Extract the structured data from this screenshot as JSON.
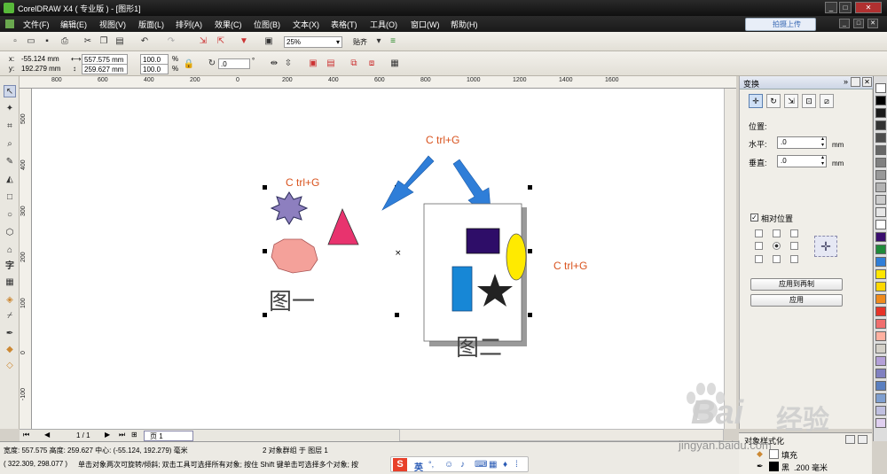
{
  "window": {
    "title": "CorelDRAW X4 ( 专业版 ) - [图形1]"
  },
  "menu": [
    "文件(F)",
    "编辑(E)",
    "视图(V)",
    "版面(L)",
    "排列(A)",
    "效果(C)",
    "位图(B)",
    "文本(X)",
    "表格(T)",
    "工具(O)",
    "窗口(W)",
    "帮助(H)"
  ],
  "upload_button": "拍摄上传",
  "toolbar": {
    "zoom": "25%",
    "snap": "贴齐"
  },
  "property_bar": {
    "x_label": "x:",
    "x": "-55.124 mm",
    "y_label": "y:",
    "y": "192.279 mm",
    "width": "557.575 mm",
    "height": "259.627 mm",
    "scale_w": "100.0",
    "scale_h": "100.0",
    "percent": "%",
    "rotation": ".0",
    "degree": "°"
  },
  "rulers": {
    "top": [
      "800",
      "600",
      "400",
      "200",
      "0",
      "200",
      "400",
      "600",
      "800",
      "1000",
      "1200",
      "1400",
      "1600"
    ],
    "left": [
      "500",
      "400",
      "300",
      "200",
      "100",
      "0",
      "-100"
    ]
  },
  "canvas": {
    "label_ctrlg_1": "C trl+G",
    "label_ctrlg_2": "C trl+G",
    "label_ctrlg_3": "C trl+G",
    "fig1_caption": "图一",
    "fig2_caption": "图二"
  },
  "docker": {
    "title": "变换",
    "position_label": "位置:",
    "h_label": "水平:",
    "h_value": ".0",
    "v_label": "垂直:",
    "v_value": ".0",
    "unit": "mm",
    "relative_label": "相对位置",
    "relative_checked": true,
    "apply_copy": "应用到再制",
    "apply": "应用"
  },
  "page_nav": {
    "counter": "1 / 1",
    "tab": "页 1"
  },
  "status": {
    "size": "宽度: 557.575 高度: 259.627 中心: (-55.124, 192.279) 毫米",
    "group": "2 对象群组 于 图层 1",
    "cursor": "( 322.309, 298.077 )",
    "hint": "单击对象两次可旋转/倾斜; 双击工具可选择所有对象; 按住 Shift 键单击可选择多个对象; 按",
    "fill_label": "填充",
    "outline_label": "黑",
    "outline_width": ".200 毫米",
    "lower_dock_title": "对象样式化"
  },
  "ime": {
    "lang": "英"
  },
  "palette": [
    "#ffffff",
    "#000000",
    "#1a1a1a",
    "#333333",
    "#4d4d4d",
    "#666666",
    "#808080",
    "#999999",
    "#b3b3b3",
    "#cccccc",
    "#e6e6e6",
    "#ffffff",
    "#3a0d6e",
    "#1f8a3a",
    "#2f7ed8",
    "#ffe600",
    "#ffd800",
    "#f08a1c",
    "#e63328",
    "#f06e6e",
    "#ffb0a0",
    "#d4d0c8",
    "#b4a0d8",
    "#8080c0",
    "#5a7fc0",
    "#7f9fd0",
    "#c0c0e0",
    "#e0d0f0"
  ],
  "watermark": {
    "brand": "Bai",
    "brand2": "经验",
    "url": "jingyan.baidu.com"
  }
}
